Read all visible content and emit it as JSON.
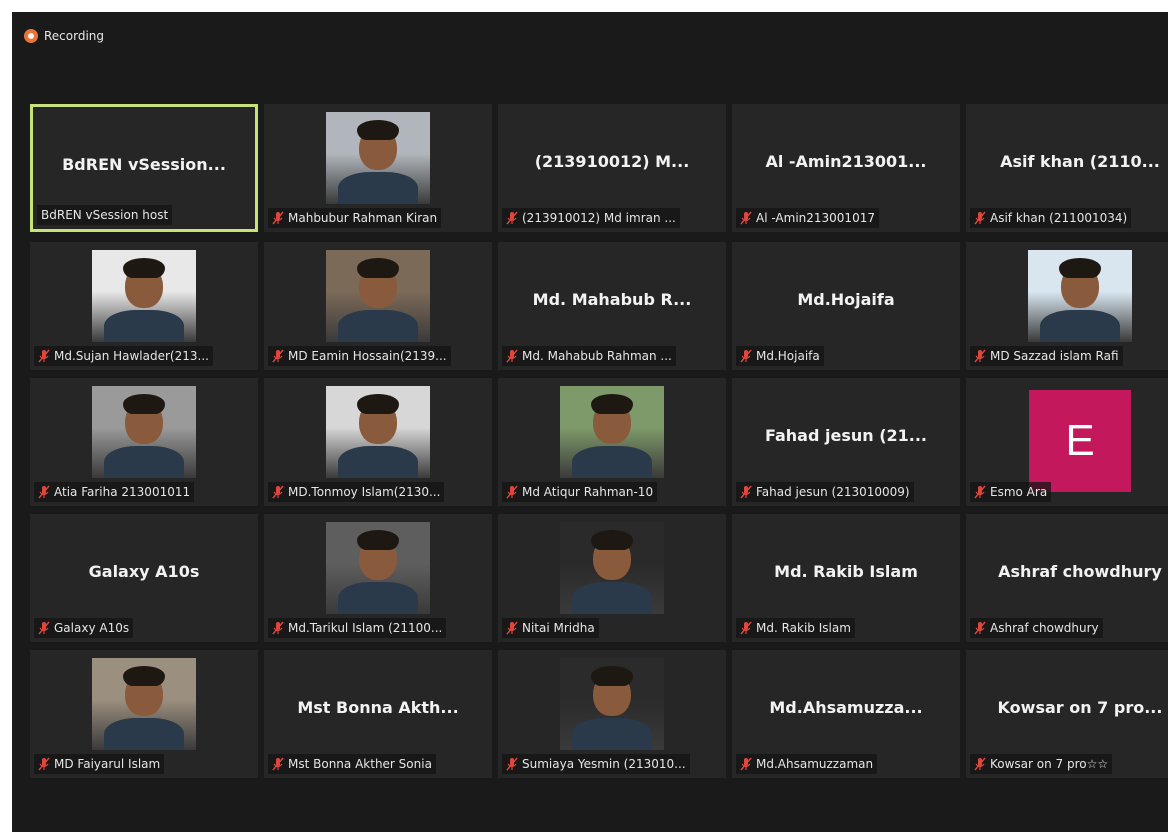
{
  "recording_label": "Recording",
  "colors": {
    "background": "#1a1a1a",
    "tile": "#262626",
    "active_border": "#c8e27a",
    "muted_icon": "#e0473c",
    "avatar_e": "#c4185c"
  },
  "participants": [
    {
      "center_name": "BdREN vSession...",
      "caption": "BdREN vSession host",
      "muted": false,
      "active": true,
      "kind": "name"
    },
    {
      "center_name": "",
      "caption": "Mahbubur Rahman Kiran",
      "muted": true,
      "kind": "photo",
      "photo_tone": "#b0b6bb"
    },
    {
      "center_name": "(213910012)  M...",
      "caption": "(213910012)  Md imran ...",
      "muted": true,
      "kind": "name"
    },
    {
      "center_name": "Al -Amin213001...",
      "caption": "Al -Amin213001017",
      "muted": true,
      "kind": "name"
    },
    {
      "center_name": "Asif khan (2110...",
      "caption": "Asif khan (211001034)",
      "muted": true,
      "kind": "name"
    },
    {
      "center_name": "",
      "caption": "Md.Sujan Hawlader(213...",
      "muted": true,
      "kind": "photo",
      "photo_tone": "#e8e8e8"
    },
    {
      "center_name": "",
      "caption": "MD Eamin Hossain(2139...",
      "muted": true,
      "kind": "photo",
      "photo_tone": "#7c6a59"
    },
    {
      "center_name": "Md. Mahabub R...",
      "caption": "Md. Mahabub Rahman ...",
      "muted": true,
      "kind": "name"
    },
    {
      "center_name": "Md.Hojaifa",
      "caption": "Md.Hojaifa",
      "muted": true,
      "kind": "name"
    },
    {
      "center_name": "",
      "caption": "MD Sazzad islam Rafi",
      "muted": true,
      "kind": "photo",
      "photo_tone": "#d9e6f0"
    },
    {
      "center_name": "",
      "caption": "Atia Fariha 213001011",
      "muted": true,
      "kind": "photo",
      "photo_tone": "#9a9a9a"
    },
    {
      "center_name": "",
      "caption": "MD.Tonmoy Islam(2130...",
      "muted": true,
      "kind": "photo",
      "photo_tone": "#d7d7d7"
    },
    {
      "center_name": "",
      "caption": "Md Atiqur Rahman-10",
      "muted": true,
      "kind": "photo",
      "photo_tone": "#7f9a6a"
    },
    {
      "center_name": "Fahad jesun (21...",
      "caption": "Fahad jesun (213010009)",
      "muted": true,
      "kind": "name"
    },
    {
      "center_name": "",
      "caption": "Esmo Ara",
      "muted": true,
      "kind": "avatar",
      "avatar_letter": "E"
    },
    {
      "center_name": "Galaxy A10s",
      "caption": "Galaxy A10s",
      "muted": true,
      "kind": "name"
    },
    {
      "center_name": "",
      "caption": "Md.Tarikul Islam (21100...",
      "muted": true,
      "kind": "photo",
      "photo_tone": "#5e5e5e"
    },
    {
      "center_name": "",
      "caption": "Nitai Mridha",
      "muted": true,
      "kind": "photo",
      "photo_tone": "#2a2a2a"
    },
    {
      "center_name": "Md. Rakib Islam",
      "caption": "Md. Rakib Islam",
      "muted": true,
      "kind": "name"
    },
    {
      "center_name": "Ashraf chowdhury",
      "caption": "Ashraf chowdhury",
      "muted": true,
      "kind": "name"
    },
    {
      "center_name": "",
      "caption": "MD Faiyarul Islam",
      "muted": true,
      "kind": "photo",
      "photo_tone": "#9b8f7f"
    },
    {
      "center_name": "Mst Bonna Akth...",
      "caption": "Mst Bonna Akther Sonia",
      "muted": true,
      "kind": "name"
    },
    {
      "center_name": "",
      "caption": "Sumiaya Yesmin (213010...",
      "muted": true,
      "kind": "photo",
      "photo_tone": "#2b2b2b"
    },
    {
      "center_name": "Md.Ahsamuzza...",
      "caption": "Md.Ahsamuzzaman",
      "muted": true,
      "kind": "name"
    },
    {
      "center_name": "Kowsar on 7 pro...",
      "caption": "Kowsar on 7 pro☆☆",
      "muted": true,
      "kind": "name"
    }
  ]
}
